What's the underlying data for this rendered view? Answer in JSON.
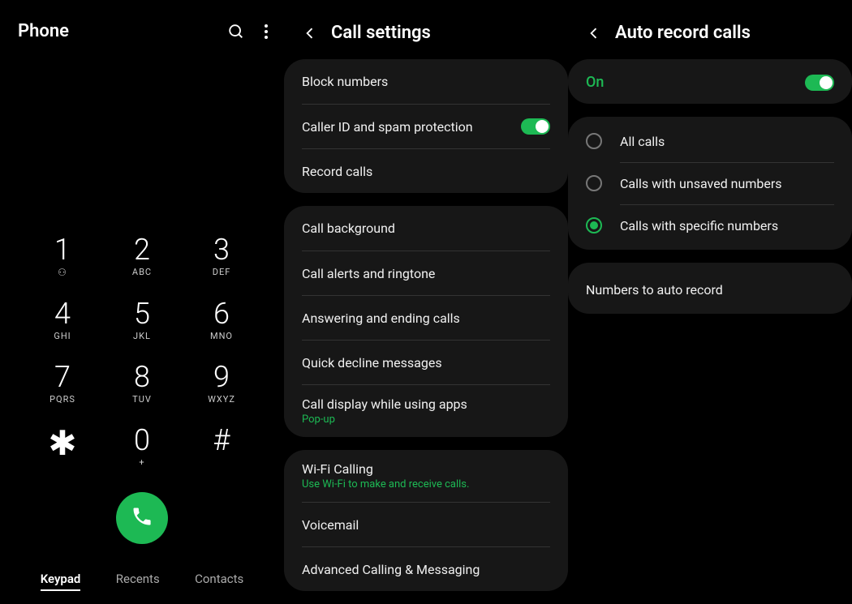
{
  "panel1": {
    "title": "Phone",
    "keys": [
      {
        "digit": "1",
        "sub": "⚇"
      },
      {
        "digit": "2",
        "sub": "ABC"
      },
      {
        "digit": "3",
        "sub": "DEF"
      },
      {
        "digit": "4",
        "sub": "GHI"
      },
      {
        "digit": "5",
        "sub": "JKL"
      },
      {
        "digit": "6",
        "sub": "MNO"
      },
      {
        "digit": "7",
        "sub": "PQRS"
      },
      {
        "digit": "8",
        "sub": "TUV"
      },
      {
        "digit": "9",
        "sub": "WXYZ"
      },
      {
        "digit": "✱",
        "sub": ""
      },
      {
        "digit": "0",
        "sub": "+"
      },
      {
        "digit": "#",
        "sub": ""
      }
    ],
    "tabs": [
      "Keypad",
      "Recents",
      "Contacts"
    ]
  },
  "panel2": {
    "title": "Call settings",
    "group1": [
      {
        "label": "Block numbers"
      },
      {
        "label": "Caller ID and spam protection",
        "toggle": true
      },
      {
        "label": "Record calls"
      }
    ],
    "group2": [
      {
        "label": "Call background"
      },
      {
        "label": "Call alerts and ringtone"
      },
      {
        "label": "Answering and ending calls"
      },
      {
        "label": "Quick decline messages"
      },
      {
        "label": "Call display while using apps",
        "sub": "Pop-up"
      }
    ],
    "group3": [
      {
        "label": "Wi-Fi Calling",
        "sub": "Use Wi-Fi to make and receive calls."
      },
      {
        "label": "Voicemail"
      },
      {
        "label": "Advanced Calling & Messaging"
      }
    ]
  },
  "panel3": {
    "title": "Auto record calls",
    "on_label": "On",
    "options": [
      {
        "label": "All calls",
        "selected": false
      },
      {
        "label": "Calls with unsaved numbers",
        "selected": false
      },
      {
        "label": "Calls with specific numbers",
        "selected": true
      }
    ],
    "extra": "Numbers to auto record"
  }
}
